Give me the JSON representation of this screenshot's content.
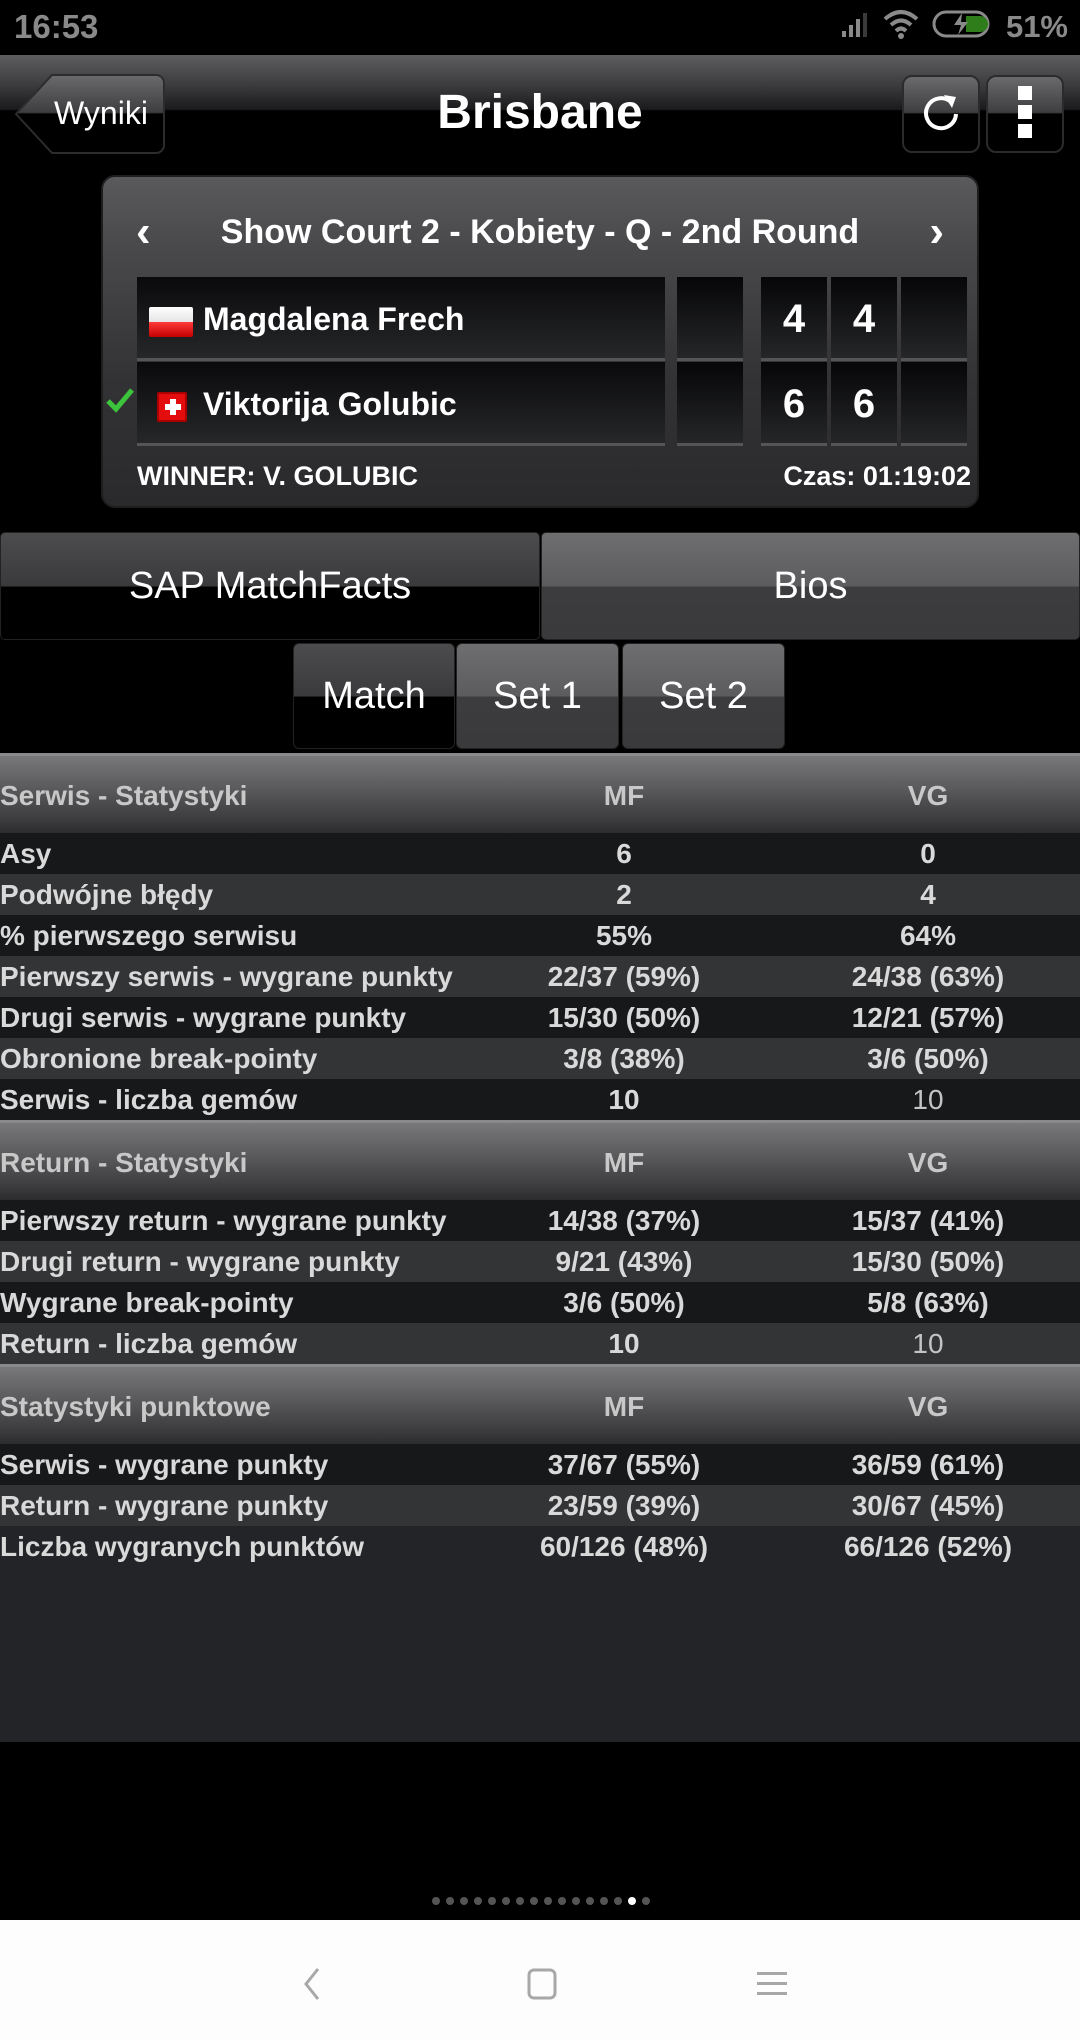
{
  "status_bar": {
    "time": "16:53",
    "battery_percent": "51%",
    "icons": [
      "signal-icon",
      "wifi-icon",
      "battery-charging-icon"
    ]
  },
  "header": {
    "back_label": "Wyniki",
    "title": "Brisbane",
    "refresh_icon": "refresh-icon",
    "menu_icon": "overflow-menu-icon"
  },
  "match": {
    "title": "Show Court 2 - Kobiety - Q - 2nd Round",
    "prev_icon": "chevron-left-icon",
    "next_icon": "chevron-right-icon",
    "players": [
      {
        "name": "Magdalena Frech",
        "flag": "Poland",
        "sets": [
          "4",
          "4",
          ""
        ],
        "winner": false
      },
      {
        "name": "Viktorija Golubic",
        "flag": "Switzerland",
        "sets": [
          "6",
          "6",
          ""
        ],
        "winner": true
      }
    ],
    "winner_text": "WINNER: V. GOLUBIC",
    "time_text": "Czas: 01:19:02",
    "winner_color": "#3cc43c"
  },
  "tabs": {
    "main": [
      {
        "label": "SAP MatchFacts",
        "active": true
      },
      {
        "label": "Bios",
        "active": false
      }
    ],
    "sub": [
      {
        "label": "Match",
        "active": true
      },
      {
        "label": "Set 1",
        "active": false
      },
      {
        "label": "Set 2",
        "active": false
      }
    ]
  },
  "stats": {
    "columns": {
      "p1": "MF",
      "p2": "VG"
    },
    "sections": [
      {
        "title": "Serwis - Statystyki",
        "rows": [
          {
            "label": "Asy",
            "mf": "6",
            "vg": "0"
          },
          {
            "label": "Podwójne błędy",
            "mf": "2",
            "vg": "4"
          },
          {
            "label": "% pierwszego serwisu",
            "mf": "55%",
            "vg": "64%"
          },
          {
            "label": "Pierwszy serwis - wygrane punkty",
            "mf": "22/37 (59%)",
            "vg": "24/38 (63%)"
          },
          {
            "label": "Drugi serwis - wygrane punkty",
            "mf": "15/30 (50%)",
            "vg": "12/21 (57%)"
          },
          {
            "label": "Obronione break-pointy",
            "mf": "3/8 (38%)",
            "vg": "3/6 (50%)"
          },
          {
            "label": "Serwis - liczba gemów",
            "mf": "10",
            "vg": "10"
          }
        ]
      },
      {
        "title": "Return - Statystyki",
        "rows": [
          {
            "label": "Pierwszy return - wygrane punkty",
            "mf": "14/38 (37%)",
            "vg": "15/37 (41%)"
          },
          {
            "label": "Drugi return - wygrane punkty",
            "mf": "9/21 (43%)",
            "vg": "15/30 (50%)"
          },
          {
            "label": "Wygrane break-pointy",
            "mf": "3/6 (50%)",
            "vg": "5/8 (63%)"
          },
          {
            "label": "Return - liczba gemów",
            "mf": "10",
            "vg": "10"
          }
        ]
      },
      {
        "title": "Statystyki punktowe",
        "rows": [
          {
            "label": "Serwis - wygrane punkty",
            "mf": "37/67 (55%)",
            "vg": "36/59 (61%)"
          },
          {
            "label": "Return - wygrane punkty",
            "mf": "23/59 (39%)",
            "vg": "30/67 (45%)"
          },
          {
            "label": "Liczba wygranych punktów",
            "mf": "60/126 (48%)",
            "vg": "66/126 (52%)"
          }
        ]
      }
    ]
  },
  "pager": {
    "total_pages": 16,
    "current_page": 15
  },
  "nav_bar": {
    "buttons": [
      "back-icon",
      "home-icon",
      "recents-icon"
    ]
  }
}
